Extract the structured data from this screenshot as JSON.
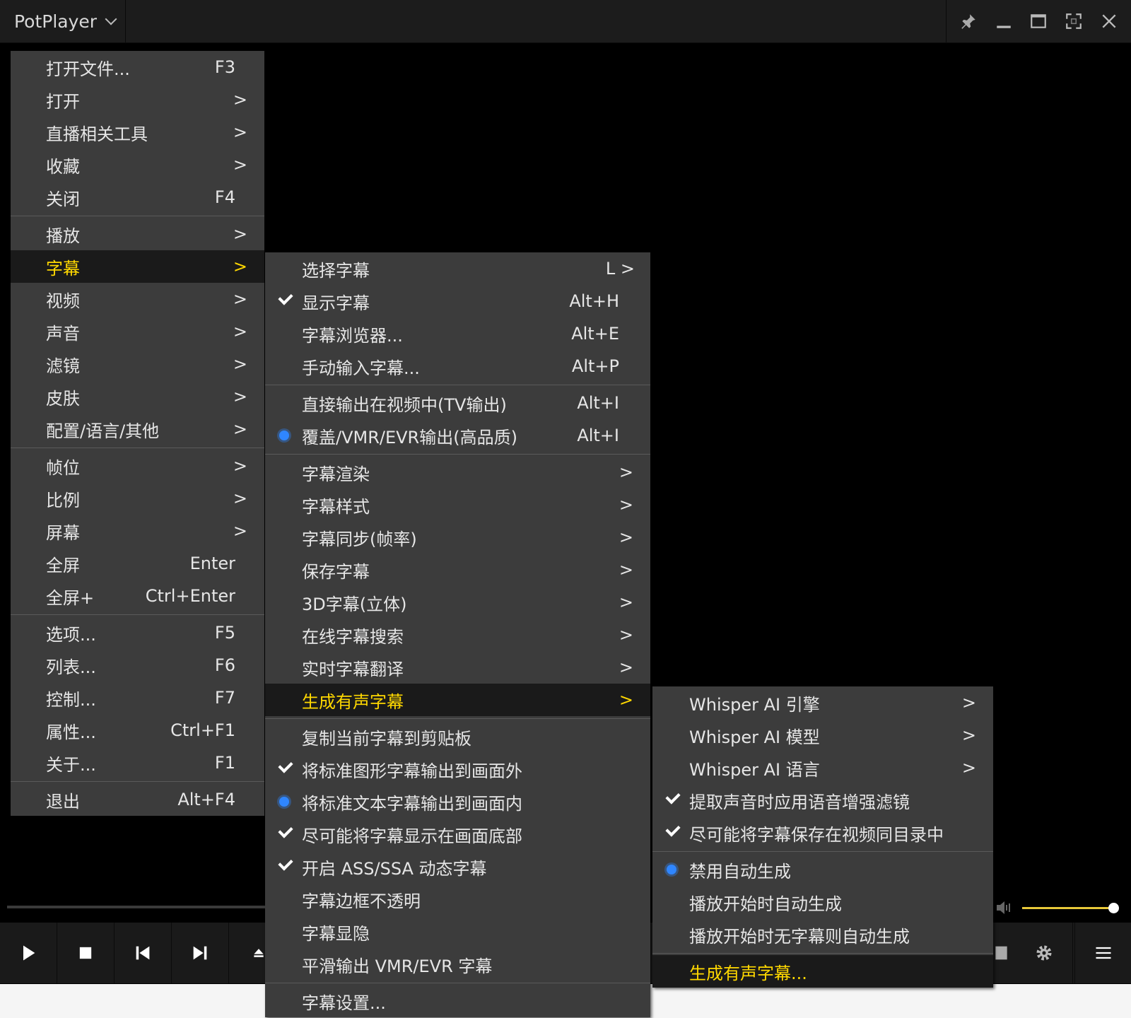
{
  "app": {
    "title": "PotPlayer"
  },
  "menu_main": {
    "items": [
      {
        "label": "打开文件...",
        "shortcut": "F3"
      },
      {
        "label": "打开",
        "arrow": ">"
      },
      {
        "label": "直播相关工具",
        "arrow": ">"
      },
      {
        "label": "收藏",
        "arrow": ">"
      },
      {
        "label": "关闭",
        "shortcut": "F4"
      },
      {
        "label": "播放",
        "arrow": ">"
      },
      {
        "label": "字幕",
        "arrow": ">"
      },
      {
        "label": "视频",
        "arrow": ">"
      },
      {
        "label": "声音",
        "arrow": ">"
      },
      {
        "label": "滤镜",
        "arrow": ">"
      },
      {
        "label": "皮肤",
        "arrow": ">"
      },
      {
        "label": "配置/语言/其他",
        "arrow": ">"
      },
      {
        "label": "帧位",
        "arrow": ">"
      },
      {
        "label": "比例",
        "arrow": ">"
      },
      {
        "label": "屏幕",
        "arrow": ">"
      },
      {
        "label": "全屏",
        "shortcut": "Enter"
      },
      {
        "label": "全屏+",
        "shortcut": "Ctrl+Enter"
      },
      {
        "label": "选项...",
        "shortcut": "F5"
      },
      {
        "label": "列表...",
        "shortcut": "F6"
      },
      {
        "label": "控制...",
        "shortcut": "F7"
      },
      {
        "label": "属性...",
        "shortcut": "Ctrl+F1"
      },
      {
        "label": "关于...",
        "shortcut": "F1"
      },
      {
        "label": "退出",
        "shortcut": "Alt+F4"
      }
    ]
  },
  "menu_subtitle": {
    "items": [
      {
        "label": "选择字幕",
        "shortcut": "L >"
      },
      {
        "label": "显示字幕",
        "shortcut": "Alt+H",
        "checked": true
      },
      {
        "label": "字幕浏览器...",
        "shortcut": "Alt+E"
      },
      {
        "label": "手动输入字幕...",
        "shortcut": "Alt+P"
      },
      {
        "label": "直接输出在视频中(TV输出)",
        "shortcut": "Alt+I"
      },
      {
        "label": "覆盖/VMR/EVR输出(高品质)",
        "shortcut": "Alt+I",
        "radio": true
      },
      {
        "label": "字幕渲染",
        "arrow": ">"
      },
      {
        "label": "字幕样式",
        "arrow": ">"
      },
      {
        "label": "字幕同步(帧率)",
        "arrow": ">"
      },
      {
        "label": "保存字幕",
        "arrow": ">"
      },
      {
        "label": "3D字幕(立体)",
        "arrow": ">"
      },
      {
        "label": "在线字幕搜索",
        "arrow": ">"
      },
      {
        "label": "实时字幕翻译",
        "arrow": ">"
      },
      {
        "label": "生成有声字幕",
        "arrow": ">"
      },
      {
        "label": "复制当前字幕到剪贴板"
      },
      {
        "label": "将标准图形字幕输出到画面外",
        "checked": true
      },
      {
        "label": "将标准文本字幕输出到画面内",
        "radio": true
      },
      {
        "label": "尽可能将字幕显示在画面底部",
        "checked": true
      },
      {
        "label": "开启 ASS/SSA 动态字幕",
        "checked": true
      },
      {
        "label": "字幕边框不透明"
      },
      {
        "label": "字幕显隐"
      },
      {
        "label": "平滑输出 VMR/EVR 字幕"
      },
      {
        "label": "字幕设置..."
      }
    ]
  },
  "menu_generate": {
    "items": [
      {
        "label": "Whisper AI 引擎",
        "arrow": ">"
      },
      {
        "label": "Whisper AI 模型",
        "arrow": ">"
      },
      {
        "label": "Whisper AI 语言",
        "arrow": ">"
      },
      {
        "label": "提取声音时应用语音增强滤镜",
        "checked": true
      },
      {
        "label": "尽可能将字幕保存在视频同目录中",
        "checked": true
      },
      {
        "label": "禁用自动生成",
        "radio": true
      },
      {
        "label": "播放开始时自动生成"
      },
      {
        "label": "播放开始时无字幕则自动生成"
      },
      {
        "label": "生成有声字幕..."
      }
    ]
  },
  "colors": {
    "highlight_text": "#ffd800",
    "radio": "#2f86ff",
    "menu_bg": "#3c3c3c"
  }
}
